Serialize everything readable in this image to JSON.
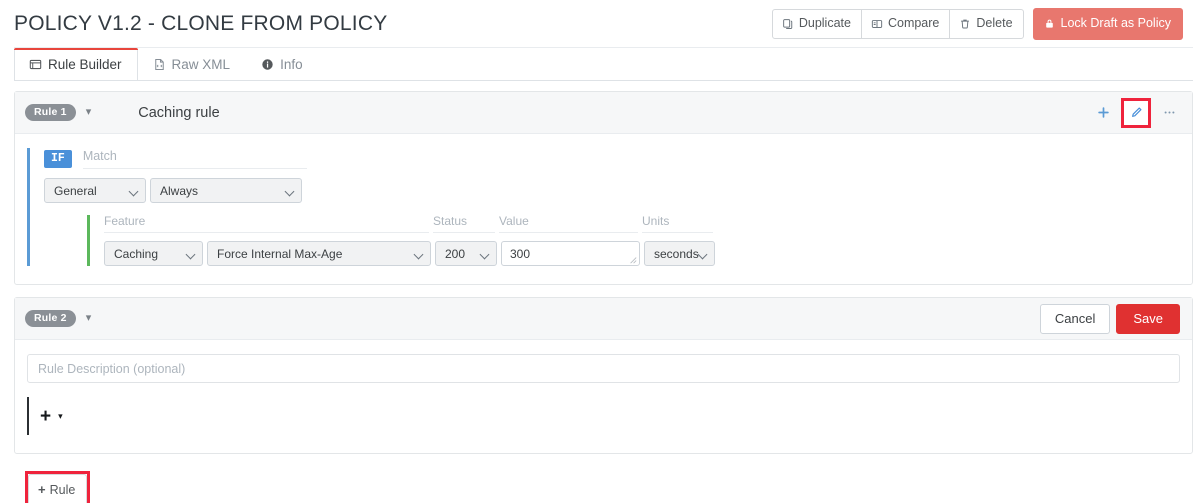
{
  "header": {
    "title": "POLICY V1.2 - CLONE FROM POLICY",
    "actions": [
      {
        "label": "Duplicate",
        "icon": "duplicate-icon"
      },
      {
        "label": "Compare",
        "icon": "compare-icon"
      },
      {
        "label": "Delete",
        "icon": "trash-icon"
      }
    ],
    "lock_button": {
      "label": "Lock Draft as Policy",
      "icon": "lock-icon",
      "color": "#e8776e"
    }
  },
  "tabs": [
    {
      "label": "Rule Builder",
      "icon": "window-icon",
      "active": true
    },
    {
      "label": "Raw XML",
      "icon": "xml-file-icon",
      "active": false
    },
    {
      "label": "Info",
      "icon": "info-circle-icon",
      "active": false
    }
  ],
  "rules": [
    {
      "badge": "Rule 1",
      "name": "Caching rule",
      "head_icons": [
        {
          "name": "add-icon",
          "glyph": "+"
        },
        {
          "name": "edit-pencil-icon",
          "glyph": "pencil",
          "highlighted": true
        },
        {
          "name": "more-options-icon",
          "glyph": "…"
        }
      ],
      "condition": {
        "tag": "IF",
        "match_label": "Match",
        "category": "General",
        "operator": "Always"
      },
      "action": {
        "labels": {
          "feature": "Feature",
          "status": "Status",
          "value": "Value",
          "units": "Units"
        },
        "feature": "Caching",
        "action_name": "Force Internal Max-Age",
        "status": "200",
        "value": "300",
        "units": "seconds"
      }
    },
    {
      "badge": "Rule 2",
      "name": "",
      "buttons": {
        "cancel": "Cancel",
        "save": "Save"
      },
      "description_placeholder": "Rule Description (optional)",
      "description_value": "",
      "add_control": {
        "plus": "+",
        "caret": "▾"
      }
    }
  ],
  "footer": {
    "add_rule": {
      "label": "Rule",
      "plus": "+",
      "highlighted": true
    }
  },
  "colors": {
    "accent_red": "#ef233c",
    "brand_red": "#e03131",
    "lock_red": "#e8776e",
    "if_blue": "#4a90d9",
    "feature_green": "#5cb85c",
    "badge_grey": "#8b9096"
  }
}
